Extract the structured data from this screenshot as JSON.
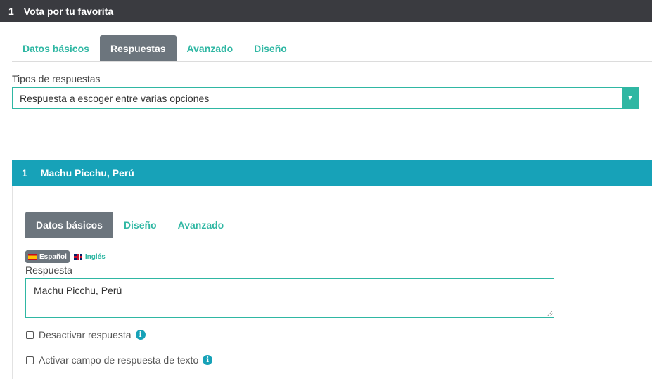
{
  "question": {
    "number": "1",
    "title": "Vota por tu favorita"
  },
  "main_tabs": [
    {
      "label": "Datos básicos",
      "active": false
    },
    {
      "label": "Respuestas",
      "active": true
    },
    {
      "label": "Avanzado",
      "active": false
    },
    {
      "label": "Diseño",
      "active": false
    }
  ],
  "answer_types": {
    "label": "Tipos de respuestas",
    "selected": "Respuesta a escoger entre varias opciones",
    "arrow_icon": "caret-down-icon"
  },
  "answer": {
    "number": "1",
    "title": "Machu Picchu, Perú",
    "tabs": [
      {
        "label": "Datos básicos",
        "active": true
      },
      {
        "label": "Diseño",
        "active": false
      },
      {
        "label": "Avanzado",
        "active": false
      }
    ],
    "languages": [
      {
        "label": "Español",
        "flag": "spain-flag-icon",
        "active": true
      },
      {
        "label": "Inglés",
        "flag": "uk-flag-icon",
        "active": false
      }
    ],
    "field_label": "Respuesta",
    "field_value": "Machu Picchu, Perú",
    "checkboxes": [
      {
        "label": "Desactivar respuesta",
        "checked": false,
        "icon": "info-icon"
      },
      {
        "label": "Activar campo de respuesta de texto",
        "checked": false,
        "icon": "info-icon"
      }
    ]
  },
  "colors": {
    "accent": "#2fb7a3",
    "header": "#17a2b8",
    "topbar": "#3a3b40",
    "active_tab": "#6c757d"
  }
}
